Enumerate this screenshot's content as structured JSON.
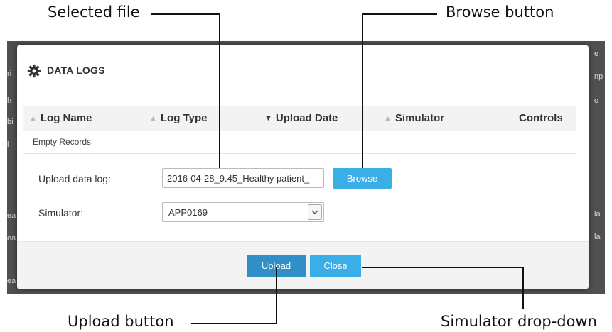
{
  "callouts": {
    "selected_file": "Selected file",
    "browse_button": "Browse button",
    "upload_button": "Upload button",
    "simulator_dropdown": "Simulator drop-down"
  },
  "background_fragments": {
    "left": [
      "ri",
      "h",
      "bi",
      "l",
      "ea",
      "ea",
      "ea"
    ],
    "right": [
      "e",
      "np",
      "o",
      "la",
      "la"
    ]
  },
  "modal": {
    "title": "DATA LOGS",
    "title_icon": "gear-icon",
    "table": {
      "columns": [
        {
          "label": "Log Name",
          "sort": "sortable"
        },
        {
          "label": "Log Type",
          "sort": "sortable"
        },
        {
          "label": "Upload Date",
          "sort": "active"
        },
        {
          "label": "Simulator",
          "sort": "sortable"
        },
        {
          "label": "Controls",
          "sort": "none"
        }
      ],
      "empty_text": "Empty Records"
    },
    "form": {
      "upload_label": "Upload data log:",
      "file_value": "2016-04-28_9.45_Healthy patient_",
      "browse_label": "Browse",
      "simulator_label": "Simulator:",
      "simulator_value": "APP0169"
    },
    "footer": {
      "upload_label": "Upload",
      "close_label": "Close"
    }
  },
  "colors": {
    "primary_button": "#2f8fc6",
    "secondary_button": "#3aaee6",
    "overlay": "#505050"
  }
}
